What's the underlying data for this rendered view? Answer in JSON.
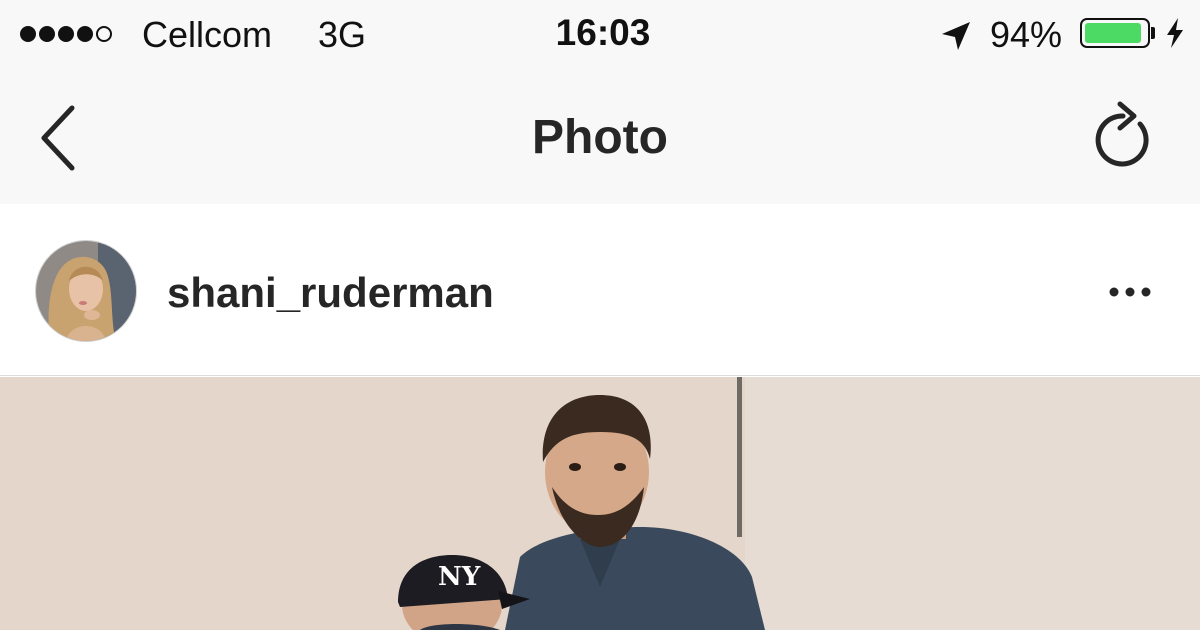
{
  "status_bar": {
    "signal_bars_filled": 4,
    "signal_bars_total": 5,
    "carrier": "Cellcom",
    "network": "3G",
    "time": "16:03",
    "battery_percent_label": "94%",
    "battery_level": 0.94,
    "icons": [
      "signal-dots-icon",
      "location-arrow-icon",
      "battery-icon",
      "charging-bolt-icon"
    ]
  },
  "nav_bar": {
    "title": "Photo",
    "icons": [
      "back-chevron-icon",
      "refresh-icon"
    ]
  },
  "post": {
    "username": "shani_ruderman",
    "icons": [
      "avatar",
      "more-options-icon"
    ]
  },
  "colors": {
    "bar_background": "#f8f8f8",
    "text": "#262626",
    "battery_green": "#4cd964",
    "divider": "#dbdbdb",
    "photo_wall": "#e4d6cb"
  }
}
